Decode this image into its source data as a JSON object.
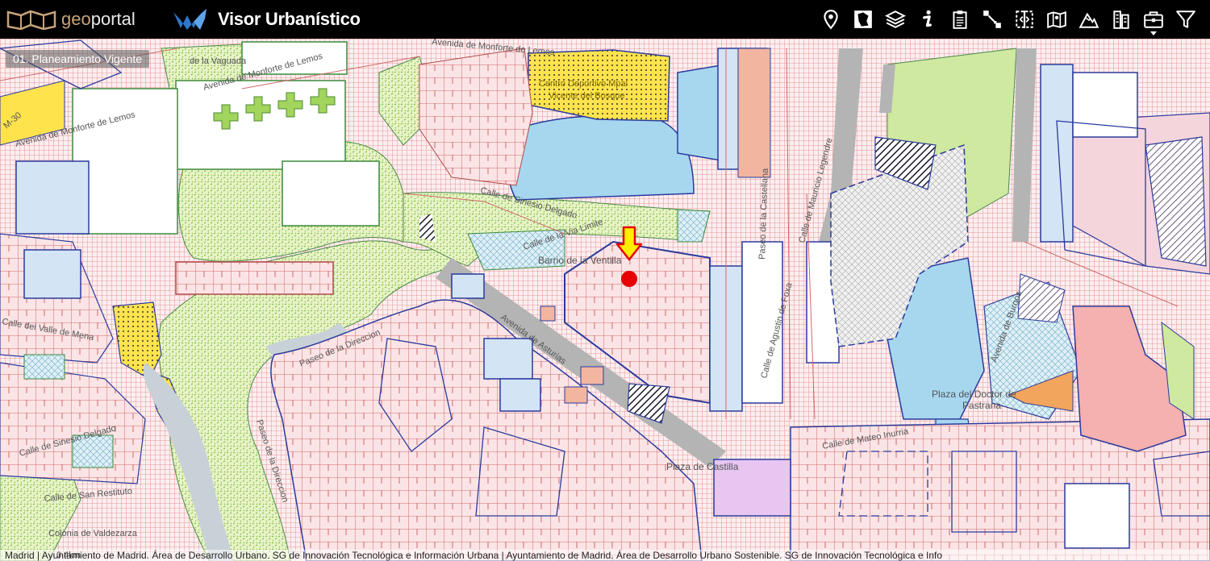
{
  "header": {
    "geo_brand_a": "geo",
    "geo_brand_b": "portal",
    "app_title": "Visor Urbanístico"
  },
  "toolbar": {
    "tools": [
      "location-pin-icon",
      "region-map-icon",
      "layers-icon",
      "info-icon",
      "clipboard-icon",
      "measure-arrows-icon",
      "compare-split-icon",
      "map-book-icon",
      "terrain-icon",
      "building-icon",
      "briefcase-icon",
      "filter-icon"
    ]
  },
  "layer_label": "01. Planeamiento Vigente",
  "map_labels": {
    "centro_deportivo_1": "Centro Deportivo Mpal",
    "centro_deportivo_2": "Vicente del Bosque",
    "barrio": "Barrio de la Ventilla",
    "avenida_asturias": "Avenida de Asturias",
    "plaza_castilla": "Plaza de Castilla",
    "plaza_pinazo_1": "Plaza del Doctor de",
    "plaza_pinazo_2": "Pastrana",
    "colonia": "Colonia de Valdezarza",
    "paseo_direccion": "Paseo de la Direccion",
    "paseo_direccion2": "Paseo de la Direccion",
    "calle_sinesio": "Calle de Sinesio Delgado",
    "calle_sinesio2": "Calle de Sinesio Delgado",
    "calle_valle_mena": "Calle del Valle de Mena",
    "calle_san_restituto": "Calle de San Restituto",
    "avenida_monforte": "Avenida de Monforte de Lemos",
    "avenida_monforte2": "Avenida de Monforte de Lemos",
    "avenida_monforte3": "Avenida de Monforte de Lemos",
    "calle_via_limite": "Calle de la Via Limite",
    "paseo_castellana": "Paseo de la Castellana",
    "calle_mauricio": "Calle de Mauricio Legendre",
    "calle_agustin": "Calle de Agustin de Foxa",
    "calle_mateo": "Calle de Mateo Inurria",
    "la_vaguada": "de la Vaguada",
    "m30": "M-30",
    "avenida_burgos": "Avenida de Burgos"
  },
  "attribution": "Madrid | Ayuntamiento de Madrid. Área de Desarrollo Urbano. SG de Innovación Tecnológica e Información Urbana | Ayuntamiento de Madrid. Área de Desarrollo Urbano Sostenible. SG de Innovación Tecnológica e Info",
  "scale_label": "0.4km",
  "colors": {
    "header_bg": "#000000",
    "grid_pink": "#e07a7a",
    "park_green": "#9ccc5a",
    "water_blue": "#a6d7ef",
    "yellow_dot": "#ffe34d",
    "block_blue": "#2b3a9c",
    "marker_red": "#e60000",
    "arrow_yellow": "#ffee00"
  }
}
